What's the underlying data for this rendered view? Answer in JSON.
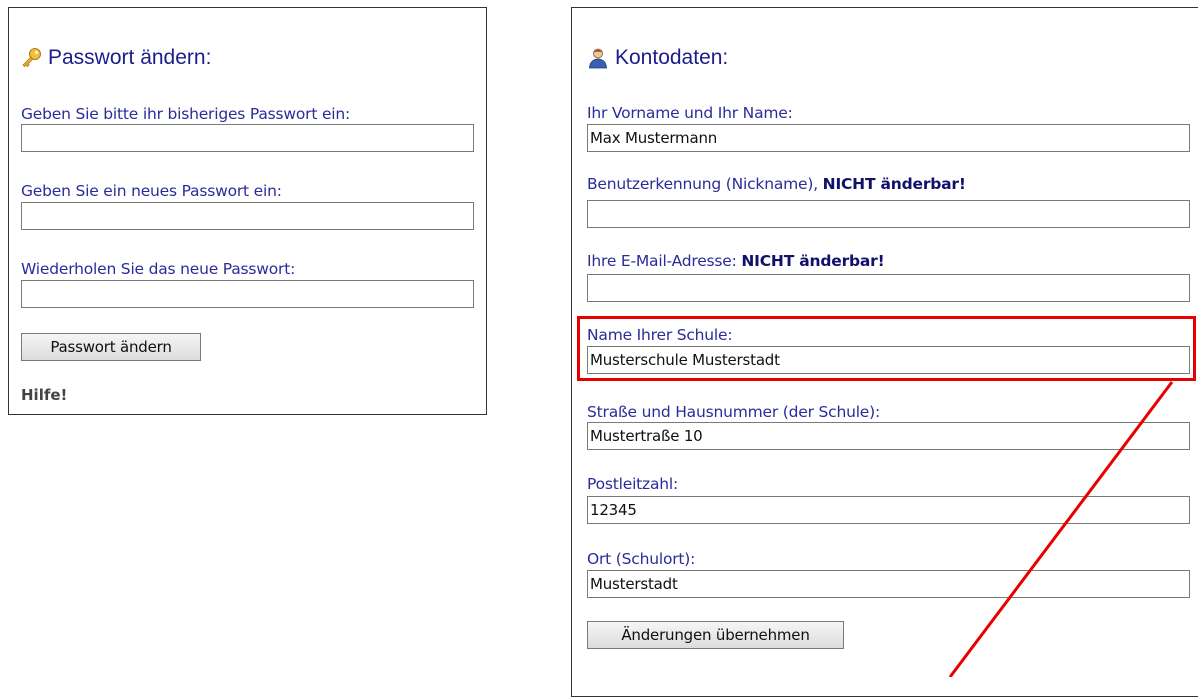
{
  "password_panel": {
    "title": "Passwort ändern:",
    "title_icon": "key-icon",
    "current_label": "Geben Sie bitte ihr bisheriges Passwort ein:",
    "current_value": "",
    "new_label": "Geben Sie ein neues Passwort ein:",
    "new_value": "",
    "repeat_label": "Wiederholen Sie das neue Passwort:",
    "repeat_value": "",
    "submit_label": "Passwort ändern",
    "help_label": "Hilfe!"
  },
  "account_panel": {
    "title": "Kontodaten:",
    "title_icon": "user-icon",
    "name_label": "Ihr Vorname und Ihr Name:",
    "name_value": "Max Mustermann",
    "nick_label": "Benutzerkennung (Nickname),",
    "nick_label_strong": "NICHT änderbar!",
    "nick_value": "",
    "email_label": "Ihre E-Mail-Adresse:",
    "email_label_strong": "NICHT änderbar!",
    "email_value": "",
    "school_label": "Name Ihrer Schule:",
    "school_value": "Musterschule Musterstadt",
    "street_label": "Straße und Hausnummer (der Schule):",
    "street_value": "Mustertraße 10",
    "zip_label": "Postleitzahl:",
    "zip_value": "12345",
    "city_label": "Ort (Schulort):",
    "city_value": "Musterstadt",
    "submit_label": "Änderungen übernehmen"
  },
  "annotation": {
    "highlight_color": "#e80000"
  }
}
